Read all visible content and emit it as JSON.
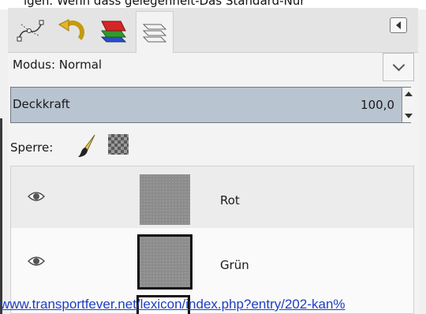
{
  "top_strip_text": "igen. Wenn dass gelegenheit-Das Standard-Nur",
  "tabs": [
    {
      "label": "Pfade",
      "icon": "paths-icon"
    },
    {
      "label": "Rückgängig",
      "icon": "undo-history-icon"
    },
    {
      "label": "Kanäle",
      "icon": "channels-icon"
    },
    {
      "label": "Ebenen",
      "icon": "layers-icon"
    }
  ],
  "mode": {
    "label": "Modus: Normal"
  },
  "opacity": {
    "label": "Deckkraft",
    "value": "100,0"
  },
  "lock": {
    "label": "Sperre:"
  },
  "layers": [
    {
      "name": "Rot",
      "visible": true,
      "selected": true
    },
    {
      "name": "Grün",
      "visible": true,
      "selected": false
    }
  ],
  "watermark": "www.transportfever.net/lexicon/index.php?entry/202-kan%"
}
